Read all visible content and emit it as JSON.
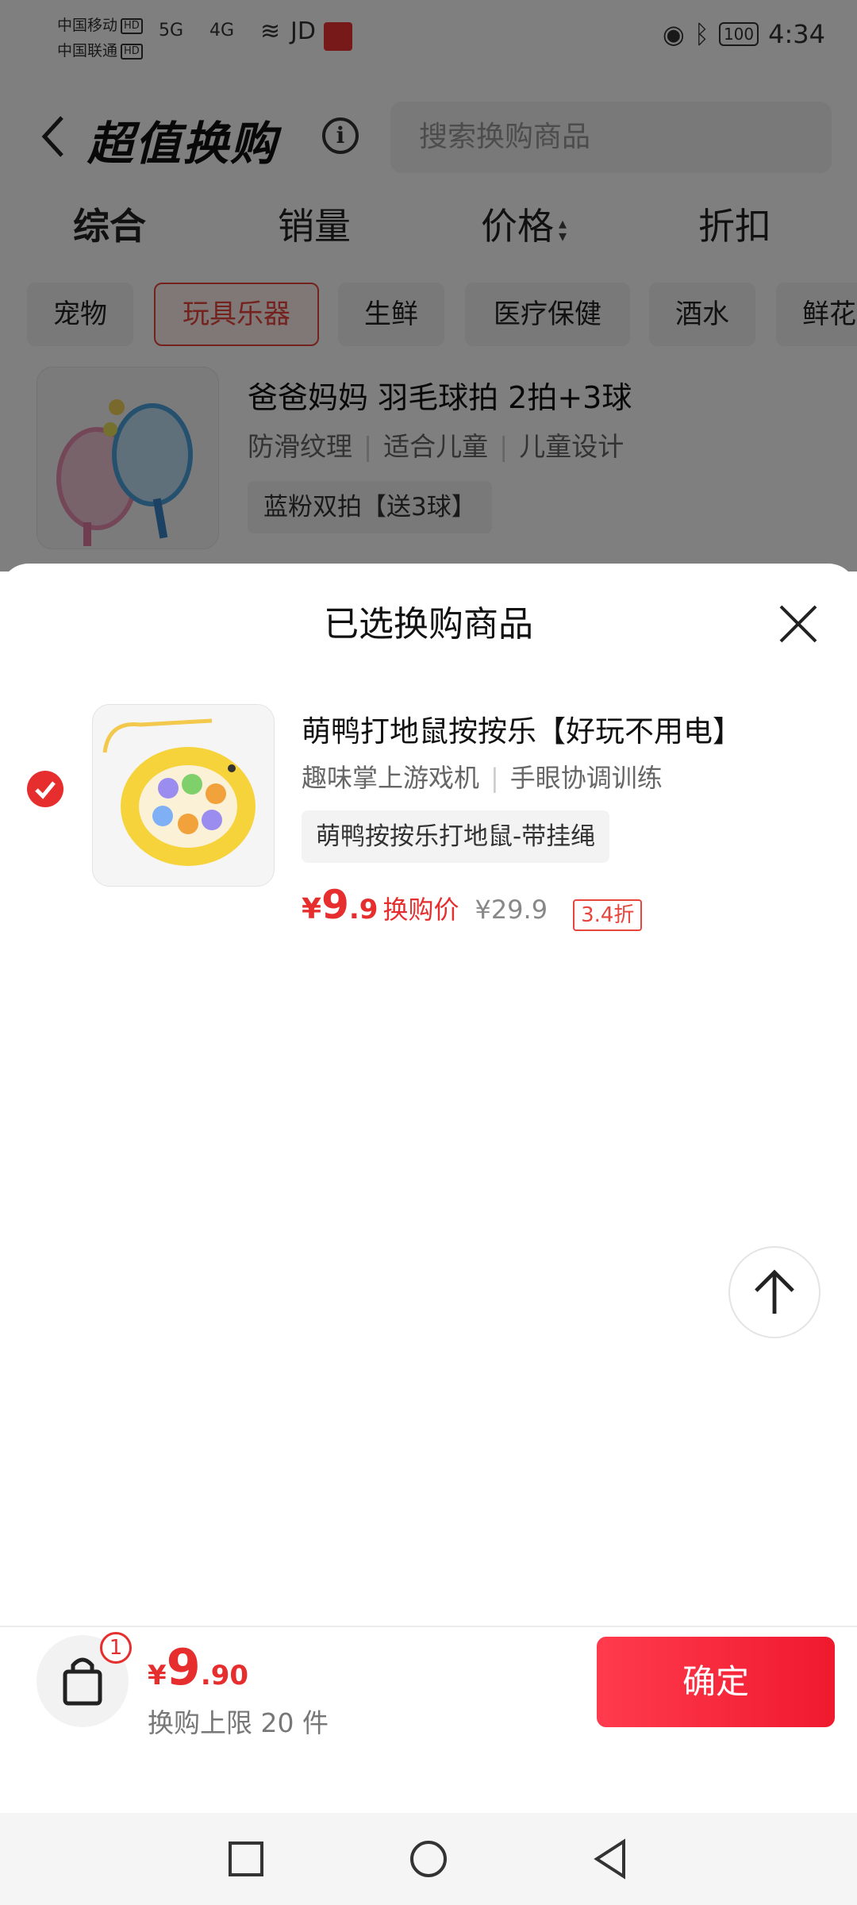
{
  "status_bar": {
    "carrier1": "中国移动",
    "carrier2": "中国联通",
    "hd": "HD",
    "sig1": "5G",
    "sig2": "4G",
    "jd": "JD",
    "battery": "100",
    "time": "4:34"
  },
  "header": {
    "title": "超值换购",
    "info_symbol": "i",
    "search_placeholder": "搜索换购商品"
  },
  "sort_tabs": [
    {
      "label": "综合"
    },
    {
      "label": "销量"
    },
    {
      "label": "价格"
    },
    {
      "label": "折扣"
    }
  ],
  "categories": [
    {
      "label": "宠物"
    },
    {
      "label": "玩具乐器"
    },
    {
      "label": "生鲜"
    },
    {
      "label": "医疗保健"
    },
    {
      "label": "酒水"
    },
    {
      "label": "鲜花"
    }
  ],
  "background_product": {
    "title": "爸爸妈妈 羽毛球拍 2拍+3球",
    "tags": [
      "防滑纹理",
      "适合儿童",
      "儿童设计"
    ],
    "spec": "蓝粉双拍【送3球】"
  },
  "sheet": {
    "title": "已选换购商品",
    "item": {
      "title": "萌鸭打地鼠按按乐【好玩不用电】",
      "tags": [
        "趣味掌上游戏机",
        "手眼协调训练"
      ],
      "spec": "萌鸭按按乐打地鼠-带挂绳",
      "price_symbol": "¥",
      "price_int": "9",
      "price_dec": ".9",
      "price_label": "换购价",
      "original_price": "¥29.9",
      "discount": "3.4折",
      "selected": true
    }
  },
  "bottom_bar": {
    "cart_count": "1",
    "price_symbol": "¥",
    "price_int": "9",
    "price_dec": ".90",
    "limit": "换购上限 20 件",
    "confirm_label": "确定"
  },
  "colors": {
    "accent": "#e62e2e",
    "button_gradient_start": "#ff3b4e",
    "button_gradient_end": "#f0192e"
  }
}
